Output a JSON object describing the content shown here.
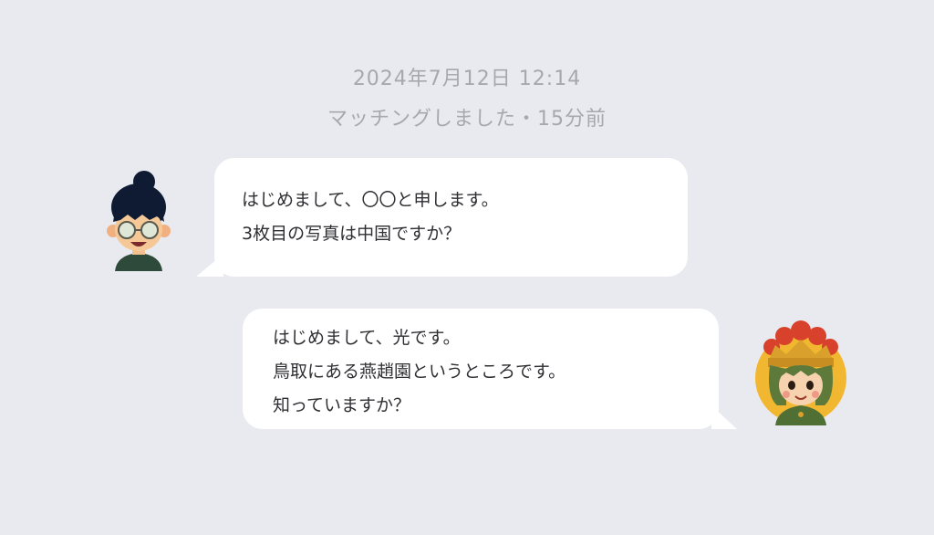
{
  "header": {
    "date_time": "2024年7月12日 12:14",
    "match_status": "マッチングしました・15分前"
  },
  "messages": [
    {
      "side": "left",
      "avatar_icon": "glasses-boy-avatar",
      "lines": [
        "はじめまして、〇〇と申します。",
        "3枚目の写真は中国ですか？"
      ]
    },
    {
      "side": "right",
      "avatar_icon": "crowned-girl-avatar",
      "lines": [
        "はじめまして、光です。",
        "鳥取にある燕趙園というところです。",
        "知っていますか？"
      ]
    }
  ],
  "colors": {
    "background": "#e9eaef",
    "bubble": "#ffffff",
    "meta_text": "#a6a8ae",
    "message_text": "#2f2f33"
  }
}
